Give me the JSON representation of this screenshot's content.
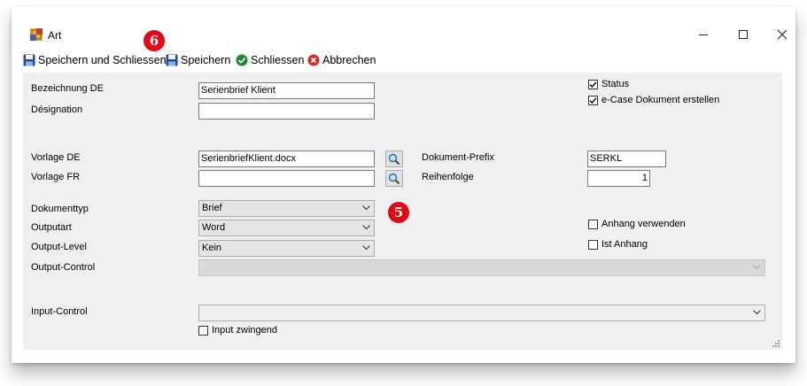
{
  "window": {
    "title": "Art"
  },
  "toolbar": {
    "save_close_label": "Speichern und Schliessen",
    "save_label": "Speichern",
    "close_label": "Schliessen",
    "cancel_label": "Abbrechen"
  },
  "markers": {
    "m6": "6",
    "m5": "5"
  },
  "form": {
    "bezeichnung_label": "Bezeichnung DE",
    "bezeichnung_value": "Serienbrief Klient",
    "designation_label": "Désignation",
    "designation_value": "",
    "vorlage_de_label": "Vorlage DE",
    "vorlage_de_value": "SerienbriefKlient.docx",
    "vorlage_fr_label": "Vorlage FR",
    "vorlage_fr_value": "",
    "dokument_prefix_label": "Dokument-Prefix",
    "dokument_prefix_value": "SERKL",
    "reihenfolge_label": "Reihenfolge",
    "reihenfolge_value": "1",
    "dokumenttyp_label": "Dokumenttyp",
    "dokumenttyp_value": "Brief",
    "outputart_label": "Outputart",
    "outputart_value": "Word",
    "output_level_label": "Output-Level",
    "output_level_value": "Kein",
    "output_control_label": "Output-Control",
    "output_control_value": "",
    "input_control_label": "Input-Control",
    "input_control_value": "",
    "status_label": "Status",
    "status_checked": true,
    "ecase_label": "e-Case Dokument erstellen",
    "ecase_checked": true,
    "anhang_verwenden_label": "Anhang verwenden",
    "anhang_verwenden_checked": false,
    "ist_anhang_label": "Ist Anhang",
    "ist_anhang_checked": false,
    "input_zwingend_label": "Input zwingend",
    "input_zwingend_checked": false
  },
  "colors": {
    "marker": "#e30613",
    "panel": "#f0f0f0",
    "accent_green": "#1e8a2e",
    "accent_red": "#d42a1f",
    "save_blue": "#1f4fa0"
  }
}
